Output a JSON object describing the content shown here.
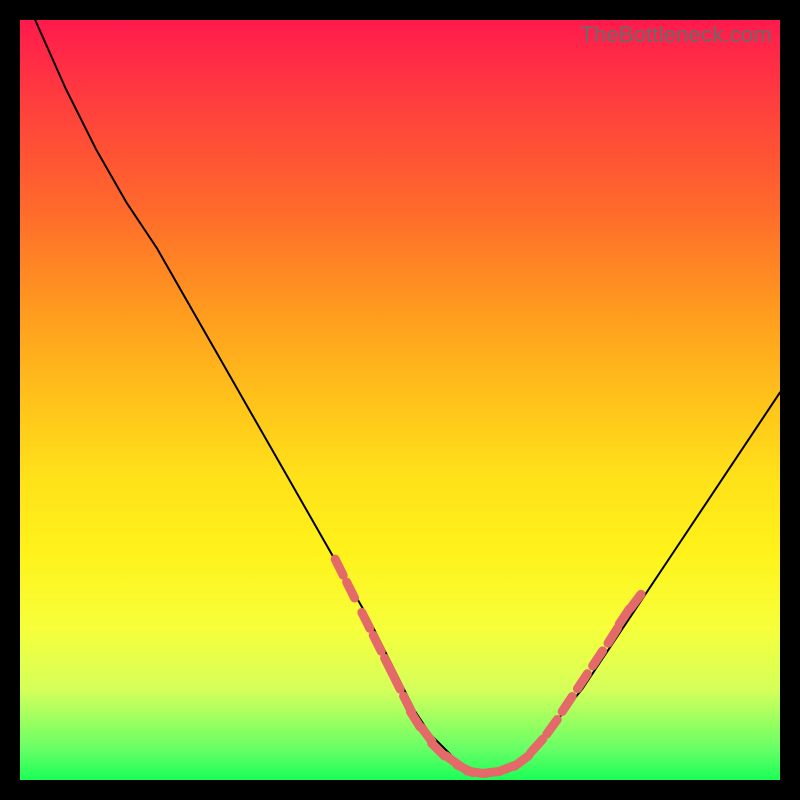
{
  "watermark": "TheBottleneck.com",
  "colors": {
    "page_bg": "#000000",
    "curve_stroke": "#000000",
    "marker_fill": "#e46a6a",
    "gradient_top": "#ff1a4d",
    "gradient_bottom": "#1aff58"
  },
  "chart_data": {
    "type": "line",
    "title": "",
    "xlabel": "",
    "ylabel": "",
    "xlim": [
      0,
      100
    ],
    "ylim": [
      0,
      100
    ],
    "grid": false,
    "legend": false,
    "series": [
      {
        "name": "curve",
        "x": [
          2,
          6,
          10,
          14,
          18,
          22,
          26,
          30,
          34,
          38,
          42,
          46,
          50,
          52,
          54,
          56,
          58,
          60,
          62,
          64,
          66,
          68,
          70,
          74,
          78,
          82,
          86,
          90,
          94,
          98,
          100
        ],
        "y": [
          100,
          91,
          83,
          76,
          70,
          63,
          56,
          49,
          42,
          35,
          28,
          21,
          13,
          9,
          6,
          4,
          2,
          1,
          1,
          1,
          2,
          4,
          7,
          12,
          18,
          24,
          30,
          36,
          42,
          48,
          51
        ]
      }
    ],
    "markers": {
      "name": "highlight-dashes",
      "points": [
        {
          "x": 42,
          "y": 28
        },
        {
          "x": 43.5,
          "y": 25
        },
        {
          "x": 45.5,
          "y": 21
        },
        {
          "x": 47,
          "y": 18
        },
        {
          "x": 48.5,
          "y": 15
        },
        {
          "x": 49.5,
          "y": 13
        },
        {
          "x": 51,
          "y": 10
        },
        {
          "x": 52,
          "y": 8
        },
        {
          "x": 53.5,
          "y": 6
        },
        {
          "x": 55,
          "y": 4
        },
        {
          "x": 57,
          "y": 2.5
        },
        {
          "x": 58.5,
          "y": 1.5
        },
        {
          "x": 60,
          "y": 1
        },
        {
          "x": 62,
          "y": 1
        },
        {
          "x": 64,
          "y": 1.5
        },
        {
          "x": 66,
          "y": 2.5
        },
        {
          "x": 68,
          "y": 4.5
        },
        {
          "x": 70,
          "y": 7
        },
        {
          "x": 72,
          "y": 10
        },
        {
          "x": 74,
          "y": 13
        },
        {
          "x": 76,
          "y": 16
        },
        {
          "x": 78,
          "y": 19
        },
        {
          "x": 79.5,
          "y": 21.5
        },
        {
          "x": 81,
          "y": 23.5
        }
      ]
    }
  }
}
